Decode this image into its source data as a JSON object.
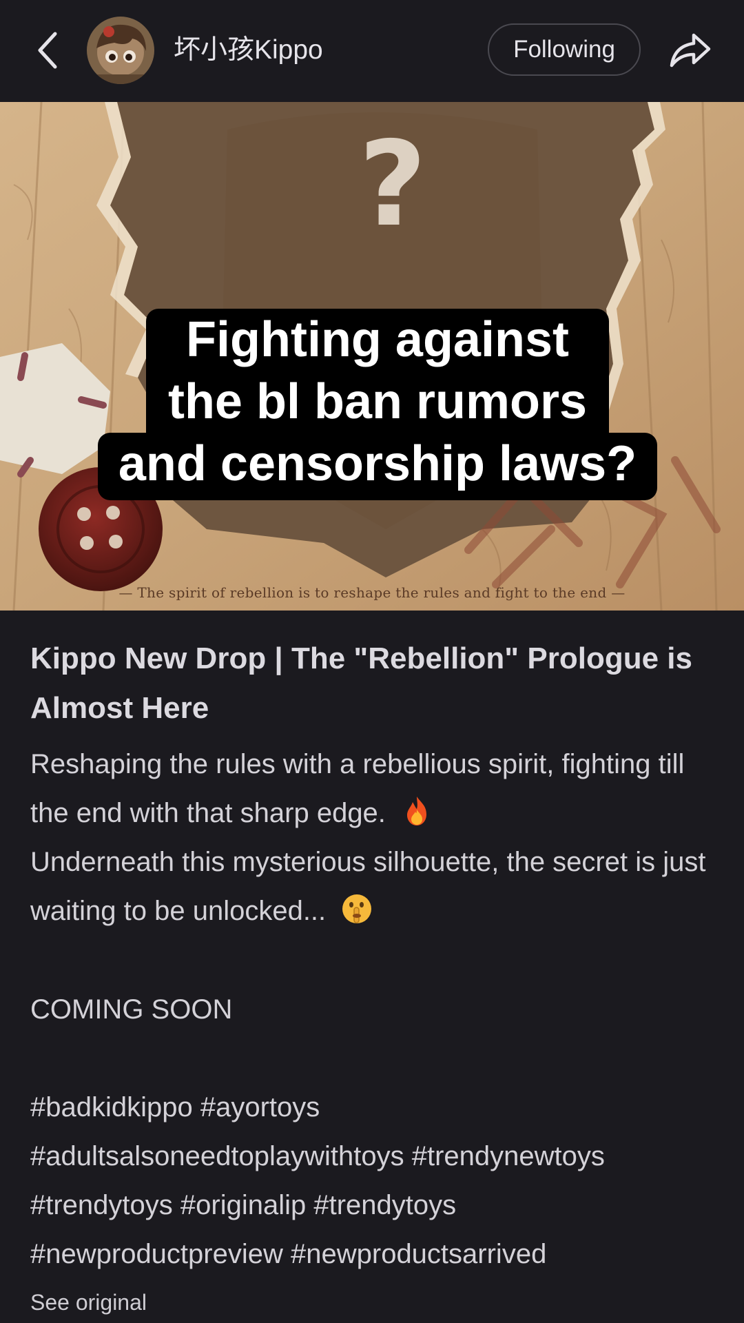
{
  "header": {
    "username": "坏小孩Kippo",
    "follow_label": "Following",
    "back_icon": "chevron-left-icon",
    "share_icon": "share-arrow-icon"
  },
  "hero": {
    "caption_lines": [
      "Fighting against",
      "the bl ban rumors",
      "and censorship laws?"
    ],
    "question_mark": "?",
    "tagline": "— The spirit of rebellion is to reshape the rules and fight to the end —"
  },
  "post": {
    "title": "Kippo New Drop | The \"Rebellion\" Prologue is Almost Here",
    "body_line1": "Reshaping the rules with a rebellious spirit, fighting till the end with that sharp edge.",
    "body_line2": "Underneath this mysterious silhouette, the secret is just waiting to be unlocked...",
    "emoji1": "fire-emoji",
    "emoji2": "shushing-face-emoji",
    "coming_soon": "COMING SOON",
    "hashtags": [
      "#badkidkippo",
      "#ayortoys",
      "#adultsalsoneedtoplaywithtoys",
      "#trendynewtoys",
      "#trendytoys",
      "#originalip",
      "#trendytoys",
      "#newproductpreview",
      "#newproductsarrived"
    ],
    "see_original": "See original"
  },
  "colors": {
    "background": "#1b1a1f",
    "text": "#d4d2d8",
    "wood": "#c9a67c",
    "silhouette": "#6e5640"
  }
}
